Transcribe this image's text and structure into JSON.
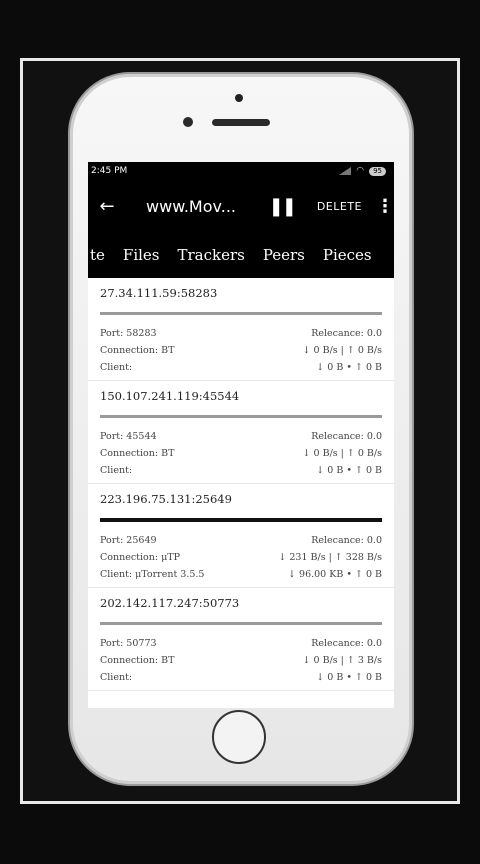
{
  "status": {
    "time": "2:45 PM",
    "battery": "95"
  },
  "appbar": {
    "back_icon": "←",
    "title": "www.Mov...",
    "pause_icon": "❚❚",
    "delete_label": "DELETE",
    "more_icon": "⋮"
  },
  "tabs": [
    "te",
    "Files",
    "Trackers",
    "Peers",
    "Pieces"
  ],
  "peers": [
    {
      "address": "27.34.111.59:58283",
      "port": "Port: 58283",
      "relevance": "Relecance: 0.0",
      "connection": "Connection: BT",
      "speed": "↓ 0 B/s | ↑ 0 B/s",
      "client": "Client:",
      "transfer": "↓ 0 B • ↑ 0 B"
    },
    {
      "address": "150.107.241.119:45544",
      "port": "Port: 45544",
      "relevance": "Relecance: 0.0",
      "connection": "Connection: BT",
      "speed": "↓ 0 B/s | ↑ 0 B/s",
      "client": "Client:",
      "transfer": "↓ 0 B • ↑ 0 B"
    },
    {
      "address": "223.196.75.131:25649",
      "port": "Port: 25649",
      "relevance": "Relecance: 0.0",
      "connection": "Connection: μTP",
      "speed": "↓ 231 B/s | ↑ 328 B/s",
      "client": "Client: μTorrent 3.5.5",
      "transfer": "↓ 96.00 KB • ↑ 0 B"
    },
    {
      "address": "202.142.117.247:50773",
      "port": "Port: 50773",
      "relevance": "Relecance: 0.0",
      "connection": "Connection: BT",
      "speed": "↓ 0 B/s | ↑ 3 B/s",
      "client": "Client:",
      "transfer": "↓ 0 B • ↑ 0 B"
    }
  ]
}
